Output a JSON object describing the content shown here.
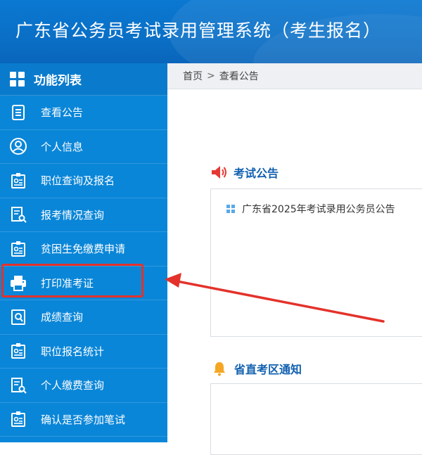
{
  "header": {
    "title": "广东省公务员考试录用管理系统（考生报名）"
  },
  "sidebar": {
    "title": "功能列表",
    "items": [
      {
        "label": "查看公告",
        "icon": "list-doc-icon"
      },
      {
        "label": "个人信息",
        "icon": "user-circle-icon"
      },
      {
        "label": "职位查询及报名",
        "icon": "id-card-icon"
      },
      {
        "label": "报考情况查询",
        "icon": "doc-search-icon"
      },
      {
        "label": "贫困生免缴费申请",
        "icon": "id-card-icon"
      },
      {
        "label": "打印准考证",
        "icon": "printer-icon"
      },
      {
        "label": "成绩查询",
        "icon": "doc-magnifier-icon"
      },
      {
        "label": "职位报名统计",
        "icon": "id-card-icon"
      },
      {
        "label": "个人缴费查询",
        "icon": "doc-search-icon"
      },
      {
        "label": "确认是否参加笔试",
        "icon": "id-card-icon"
      }
    ]
  },
  "breadcrumb": {
    "home": "首页",
    "separator": ">",
    "current": "查看公告"
  },
  "exam_notice": {
    "title": "考试公告",
    "items": [
      "广东省2025年考试录用公务员公告"
    ]
  },
  "exam_area_notice": {
    "title": "省直考区通知"
  },
  "colors": {
    "header": "#0a6fc6",
    "sidebar": "#0a86d8",
    "highlight": "#e3322b",
    "section_title": "#1160b0"
  }
}
